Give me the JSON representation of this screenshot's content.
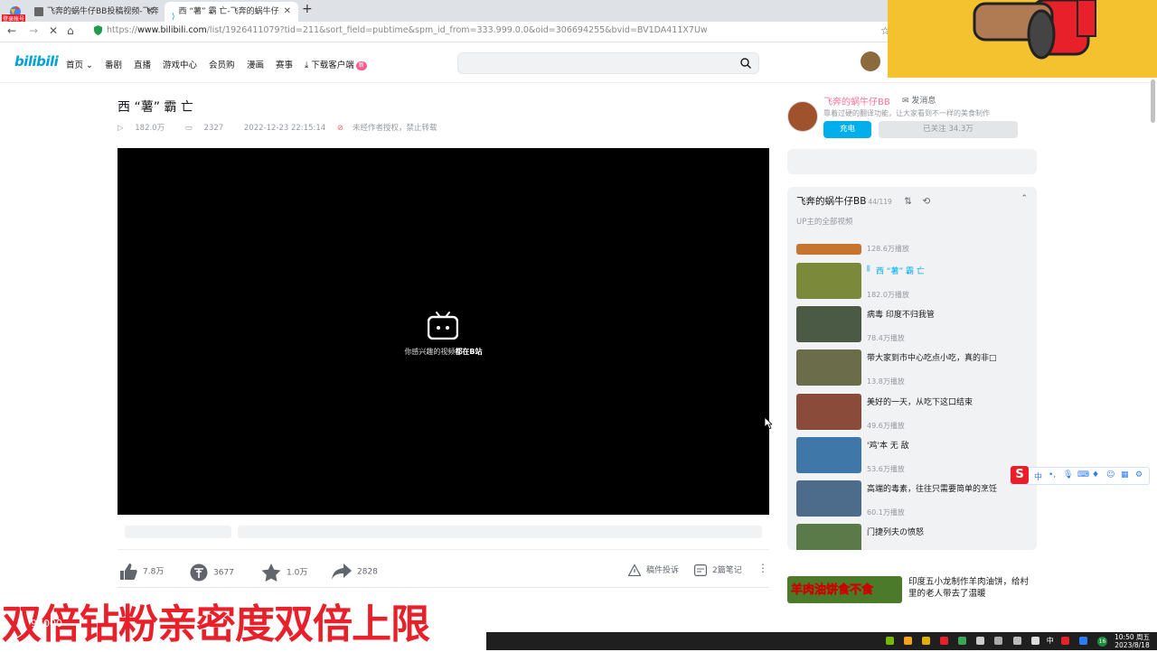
{
  "browser": {
    "tabs": [
      {
        "title": "飞奔的蜗牛仔BB投稿视频-飞奔",
        "active": false
      },
      {
        "title": "西 “薯” 霸 亡-飞奔的蜗牛仔",
        "active": true
      }
    ],
    "profile_badge": "登录账号",
    "url_prefix": "https://",
    "url_host": "www.bilibili.com",
    "url_path": "/list/1926411079?tid=211&sort_field=pubtime&spm_id_from=333.999.0.0&oid=306694255&bvid=BV1DA411X7Uw"
  },
  "site_header": {
    "logo": "bilibili",
    "nav": [
      "首页",
      "番剧",
      "直播",
      "游戏中心",
      "会员购",
      "漫画",
      "赛事",
      "下载客户端"
    ],
    "download_badge": "新",
    "search_placeholder": ""
  },
  "video": {
    "title": "西 “薯” 霸 亡",
    "views": "182.0万",
    "danmaku": "2327",
    "date": "2022-12-23 22:15:14",
    "copyright": "未经作者授权，禁止转载",
    "player_text_prefix": "你感兴趣的视频",
    "player_text_bold": "都在B站"
  },
  "toolbar": {
    "like": "7.8万",
    "coin": "3677",
    "fav": "1.0万",
    "share": "2828",
    "report": "稿件投诉",
    "notes": "2篇笔记"
  },
  "uploader": {
    "name": "飞奔的蜗牛仔BB",
    "message": "发消息",
    "desc": "靠着过硬的翻译功能，让大家看到不一样的美食制作",
    "charge": "充电",
    "follow": "已关注 34.3万"
  },
  "playlist": {
    "title": "飞奔的蜗牛仔BB",
    "count": "44/119",
    "subtitle": "UP主的全部视频",
    "items": [
      {
        "name": "",
        "plays": "128.6万播放",
        "current": false,
        "color": "#c7742e"
      },
      {
        "name": "西 “薯” 霸 亡",
        "plays": "182.0万播放",
        "current": true,
        "color": "#7a8a3a"
      },
      {
        "name": "病毒 印度不归我管",
        "plays": "78.4万播放",
        "current": false,
        "color": "#4b5a45"
      },
      {
        "name": "带大家到市中心吃点小吃，真的非□",
        "plays": "13.8万播放",
        "current": false,
        "color": "#6b6d4a"
      },
      {
        "name": "美好的一天，从吃下这口结束",
        "plays": "49.6万播放",
        "current": false,
        "color": "#8a4b3a"
      },
      {
        "name": "'鸡'本 无 敌",
        "plays": "53.6万播放",
        "current": false,
        "color": "#3f78a8"
      },
      {
        "name": "高端的毒素，往往只需要简单的烹饪",
        "plays": "60.1万播放",
        "current": false,
        "color": "#4d6b8a"
      },
      {
        "name": "门捷列夫の愤怒",
        "plays": "",
        "current": false,
        "color": "#5a7a4a"
      }
    ]
  },
  "recommend": {
    "thumb_text": "羊肉油饼食不食",
    "title": "印度五小龙制作羊肉油饼，给村里的老人带去了温暖"
  },
  "overlay": {
    "banner": "双倍钻粉亲密度双倍上限",
    "banner_sub": "97000"
  },
  "ime": {
    "logo": "S",
    "mode": "中"
  },
  "taskbar": {
    "time": "10:50 周五",
    "date": "2023/8/18",
    "notif": "16"
  },
  "colors": {
    "accent": "#00aeec",
    "pink": "#fb7299",
    "banner_red": "#e8202a"
  }
}
